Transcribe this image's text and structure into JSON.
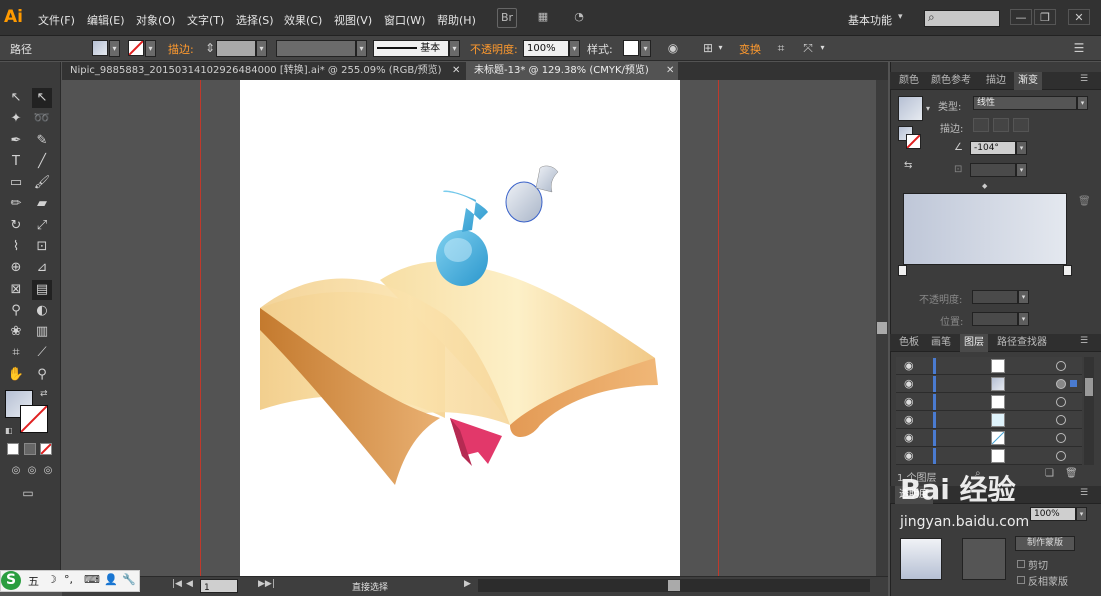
{
  "app": {
    "logo": "Ai",
    "workspace": "基本功能"
  },
  "menu": [
    "文件(F)",
    "编辑(E)",
    "对象(O)",
    "文字(T)",
    "选择(S)",
    "效果(C)",
    "视图(V)",
    "窗口(W)",
    "帮助(H)"
  ],
  "menubar_icons": {
    "bridge": "Br",
    "arrange": "▦",
    "gpu": "◔"
  },
  "window_controls": {
    "minimize": "—",
    "restore": "❐",
    "close": "✕"
  },
  "control": {
    "selection_label": "路径",
    "stroke_label": "描边:",
    "stroke_style": "基本",
    "opacity_label": "不透明度:",
    "opacity_value": "100%",
    "style_label": "样式:",
    "transform_label": "变换",
    "drop_arrow": "▾"
  },
  "tabs": [
    {
      "label": "Nipic_9885883_20150314102926484000 [转换].ai* @ 255.09% (RGB/预览)",
      "close": "✕"
    },
    {
      "label": "未标题-13* @ 129.38% (CMYK/预览)",
      "close": "✕"
    }
  ],
  "status": {
    "text": "直接选择",
    "zoom": "1"
  },
  "ime": {
    "logo": "S",
    "mode": "五",
    "icons": [
      "☽",
      "°,",
      "⌨",
      "👤",
      "🔧"
    ]
  },
  "panels": {
    "gradient_tabs": [
      "颜色",
      "颜色参考",
      "描边",
      "渐变"
    ],
    "type_label": "类型:",
    "type_value": "线性",
    "stroke_label": "描边:",
    "angle_value": "-104°",
    "opacity_label": "不透明度:",
    "position_label": "位置:",
    "layers_tabs": [
      "色板",
      "画笔",
      "图层",
      "路径查找器"
    ],
    "layer_count": "1 个图层",
    "transparency_label": "透明度",
    "transparency_value": "100%",
    "make_mask": "制作蒙版",
    "clip": "剪切",
    "invert_mask": "反相蒙版"
  },
  "watermark": "Bai 经验",
  "watermark_sub": "jingyan.baidu.com"
}
